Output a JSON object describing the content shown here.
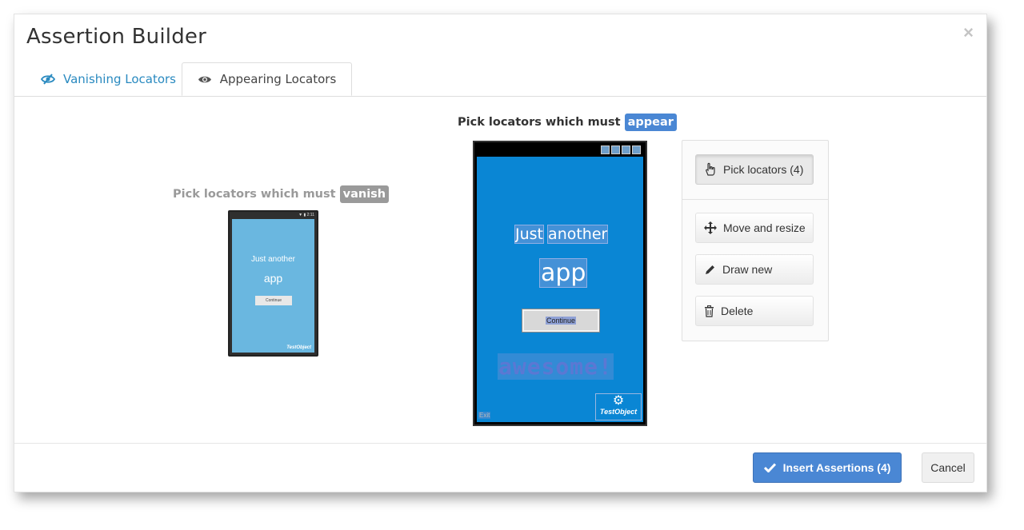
{
  "modal": {
    "title": "Assertion Builder",
    "close_glyph": "×"
  },
  "tabs": [
    {
      "label": "Vanishing Locators",
      "icon": "eye-slash-icon",
      "active": false
    },
    {
      "label": "Appearing Locators",
      "icon": "eye-icon",
      "active": true
    }
  ],
  "vanish_panel": {
    "prefix": "Pick locators which must",
    "badge": "vanish",
    "phone": {
      "text_line1": "Just another",
      "text_line2": "app",
      "button_label": "Continue",
      "logo": "TestObject",
      "status": "▼ ▮ 2:11"
    }
  },
  "appear_panel": {
    "prefix": "Pick locators which must",
    "badge": "appear",
    "phone": {
      "word1": "Just",
      "word2": "another",
      "text_line2": "app",
      "button_label": "Continue",
      "awesome": "awesome!",
      "exit": "Exit",
      "logo": "TestObject"
    }
  },
  "tools": {
    "pick": "Pick locators (4)",
    "move": "Move and resize",
    "draw": "Draw new",
    "delete": "Delete"
  },
  "footer": {
    "insert": "Insert Assertions (4)",
    "cancel": "Cancel"
  },
  "colors": {
    "primary": "#4a87d4",
    "link": "#2a8ac0",
    "phone_screen": "#0a86d4",
    "vanish_badge": "#9a9a9a"
  }
}
